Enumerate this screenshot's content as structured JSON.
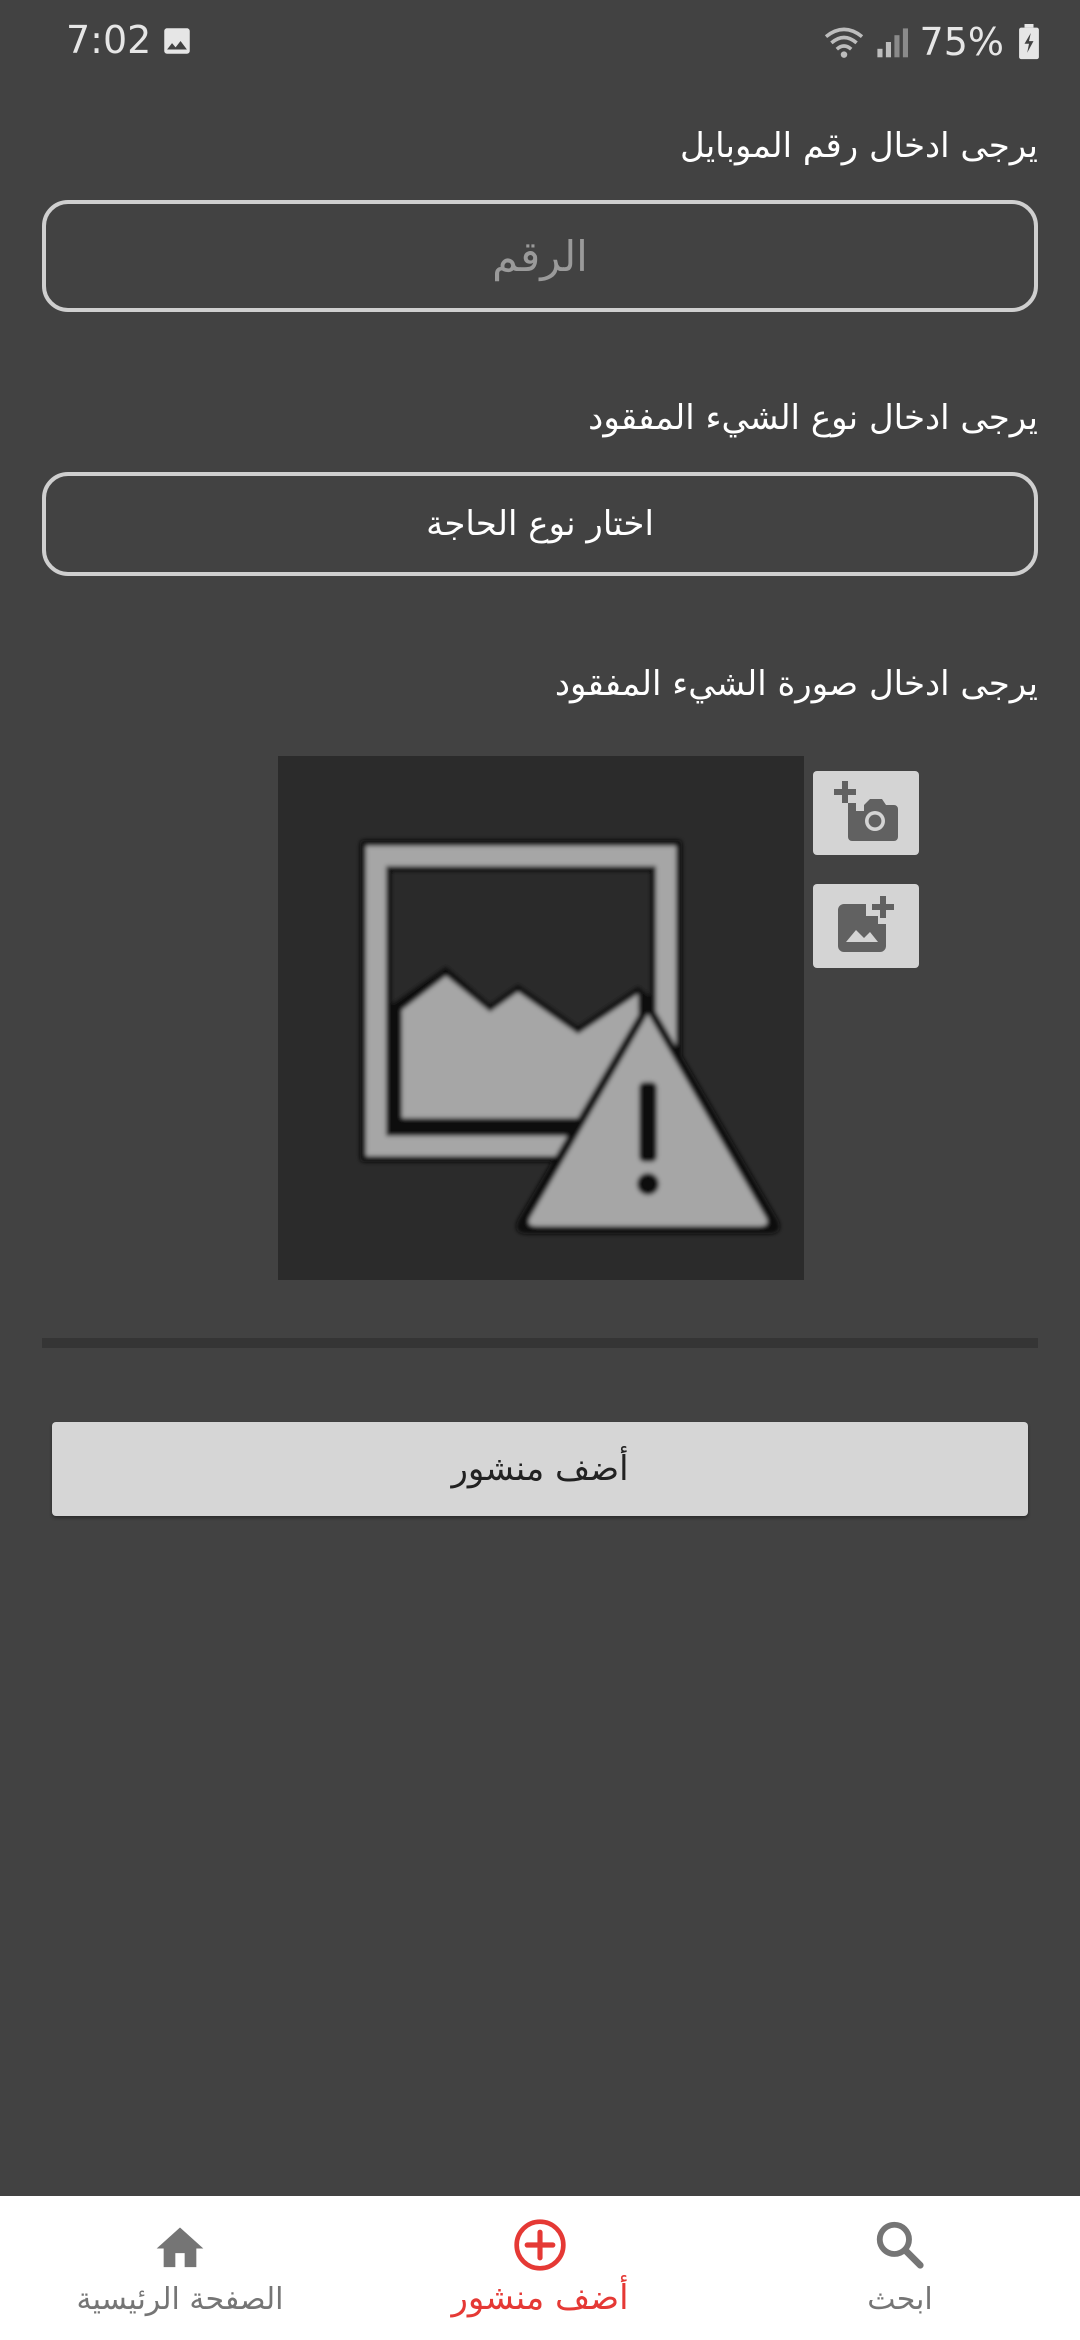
{
  "status_bar": {
    "time": "7:02",
    "battery": "75%"
  },
  "form": {
    "phone_label": "يرجى ادخال رقم الموبايل",
    "phone_placeholder": "الرقم",
    "type_label": "يرجى ادخال نوع الشيء المفقود",
    "type_value": "اختار نوع الحاجة",
    "image_label": "يرجى ادخال صورة الشيء المفقود",
    "submit_label": "أضف منشور"
  },
  "bottom_nav": {
    "items": [
      {
        "label": "الصفحة الرئيسية",
        "icon": "home-icon",
        "active": false
      },
      {
        "label": "أضف منشور",
        "icon": "add-circle-icon",
        "active": true
      },
      {
        "label": "ابحث",
        "icon": "search-icon",
        "active": false
      }
    ]
  },
  "colors": {
    "background": "#424242",
    "accent": "#e53935",
    "nav_inactive": "#757575",
    "button_bg": "#d6d6d6"
  }
}
